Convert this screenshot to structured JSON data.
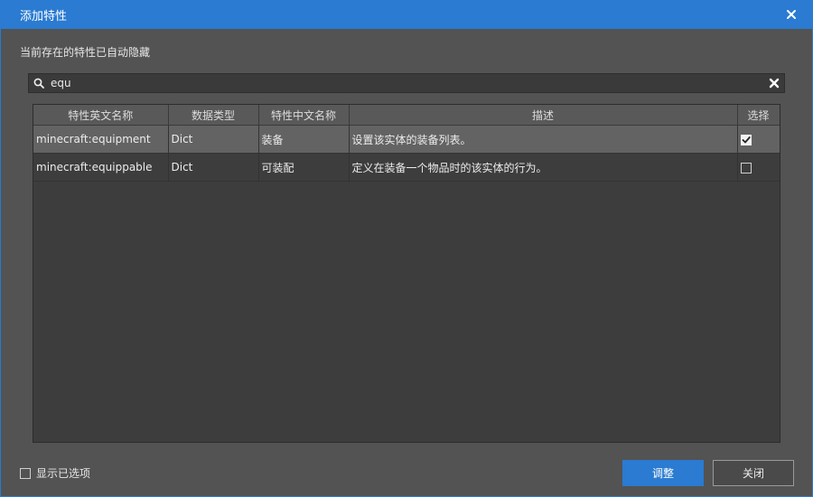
{
  "window": {
    "title": "添加特性"
  },
  "hint": "当前存在的特性已自动隐藏",
  "search": {
    "value": "equ"
  },
  "table": {
    "headers": [
      "特性英文名称",
      "数据类型",
      "特性中文名称",
      "描述",
      "选择"
    ],
    "rows": [
      {
        "en_name": "minecraft:equipment",
        "type": "Dict",
        "cn_name": "装备",
        "desc": "设置该实体的装备列表。",
        "selected": true
      },
      {
        "en_name": "minecraft:equippable",
        "type": "Dict",
        "cn_name": "可装配",
        "desc": "定义在装备一个物品时的该实体的行为。",
        "selected": false
      }
    ]
  },
  "footer": {
    "show_selected_label": "显示已选项",
    "adjust_label": "调整",
    "close_label": "关闭"
  },
  "colors": {
    "accent": "#2a7bd1",
    "background": "#535353"
  }
}
